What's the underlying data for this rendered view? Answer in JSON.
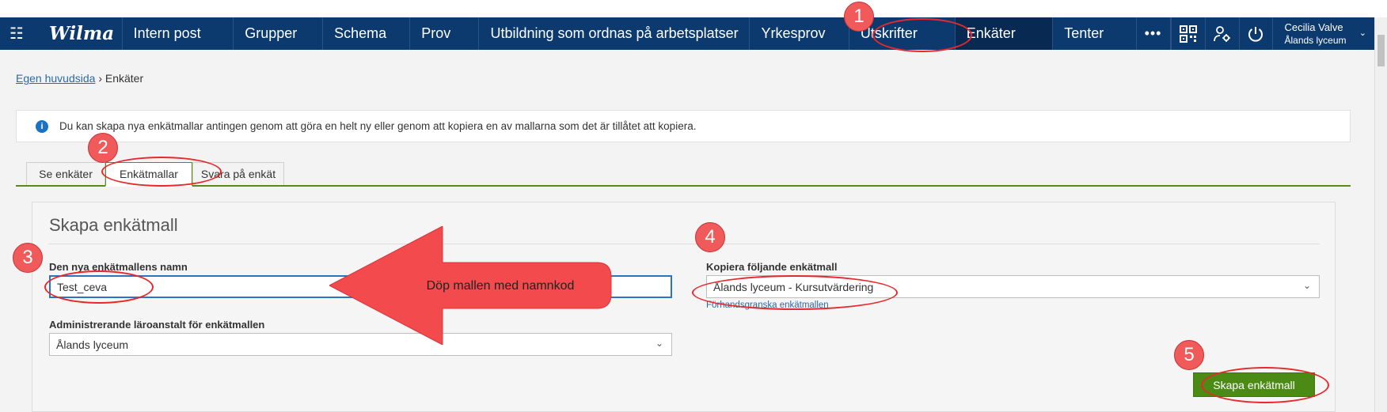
{
  "navbar": {
    "logo": "Wilma",
    "items": [
      "Intern post",
      "Grupper",
      "Schema",
      "Prov",
      "Utbildning som ordnas på arbetsplatser",
      "Yrkesprov",
      "Utskrifter",
      "Enkäter",
      "Tenter"
    ],
    "more": "•••",
    "user_name": "Cecilia Valve",
    "user_school": "Ålands lyceum"
  },
  "breadcrumb": {
    "home": "Egen huvudsida",
    "separator": "›",
    "current": "Enkäter"
  },
  "info": {
    "text": "Du kan skapa nya enkätmallar antingen genom att göra en helt ny eller genom att kopiera en av mallarna som det är tillåtet att kopiera."
  },
  "tabs": [
    "Se enkäter",
    "Enkätmallar",
    "Svara på enkät"
  ],
  "form": {
    "title": "Skapa enkätmall",
    "name_label": "Den nya enkätmallens namn",
    "name_value": "Test_ceva",
    "admin_label": "Administrerande läroanstalt för enkätmallen",
    "admin_value": "Ålands lyceum",
    "copy_label": "Kopiera följande enkätmall",
    "copy_value": "Ålands lyceum - Kursutvärdering",
    "preview_link": "Förhandsgranska enkätmallen",
    "submit": "Skapa enkätmall"
  },
  "annotations": {
    "numbers": [
      "1",
      "2",
      "3",
      "4",
      "5"
    ],
    "arrow_text": "Döp mallen med namnkod"
  },
  "colors": {
    "nav_bg": "#0d3a6e",
    "accent_green": "#4b8a14",
    "annotation_red": "#e8282b"
  }
}
